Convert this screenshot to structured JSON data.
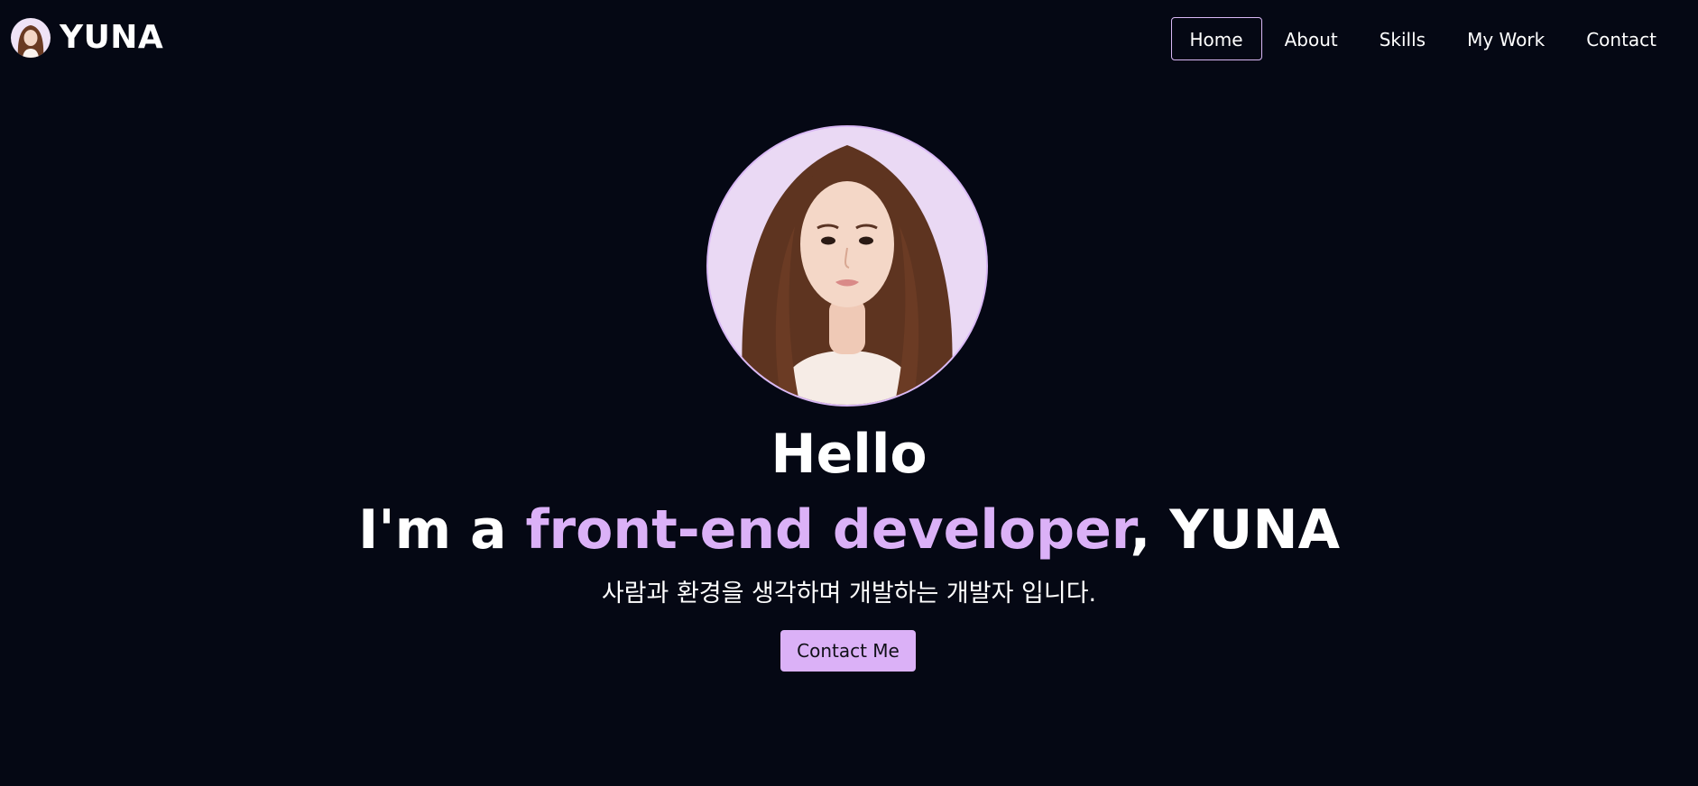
{
  "header": {
    "logo_text": "YUNA",
    "nav": [
      {
        "label": "Home",
        "active": true
      },
      {
        "label": "About",
        "active": false
      },
      {
        "label": "Skills",
        "active": false
      },
      {
        "label": "My Work",
        "active": false
      },
      {
        "label": "Contact",
        "active": false
      }
    ]
  },
  "hero": {
    "greeting": "Hello",
    "intro_prefix": "I'm a ",
    "intro_highlight": "front-end developer",
    "intro_suffix": ", YUNA",
    "description": "사람과 환경을 생각하며 개발하는 개발자 입니다.",
    "cta_label": "Contact Me"
  },
  "colors": {
    "background": "#050814",
    "accent": "#dbb1f7",
    "text": "#ffffff"
  },
  "icons": {
    "logo_avatar": "profile-photo",
    "hero_image": "profile-portrait-photo"
  }
}
